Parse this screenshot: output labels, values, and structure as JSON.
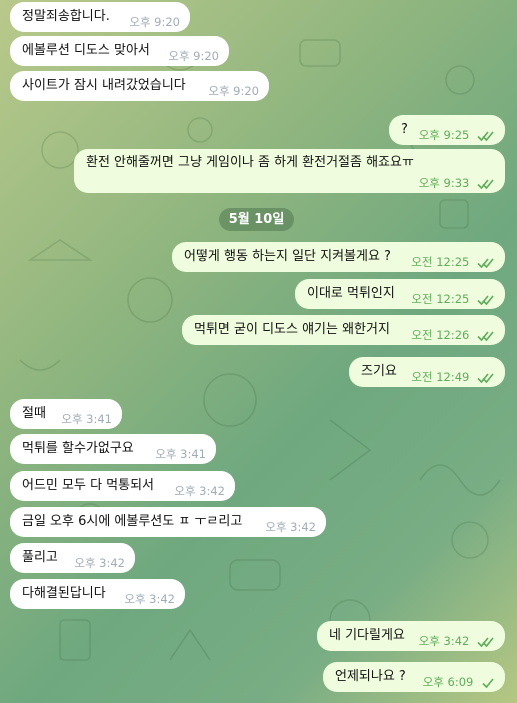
{
  "date_separator": "5월 10일",
  "colors": {
    "incoming_bubble": "#ffffff",
    "outgoing_bubble": "#effdde",
    "outgoing_meta": "#5fad5a",
    "incoming_meta": "#a0acb6"
  },
  "messages": [
    {
      "side": "in",
      "text": "정말죄송합니다.",
      "time": "오후 9:20"
    },
    {
      "side": "in",
      "text": "에볼루션 디도스 맞아서",
      "time": "오후 9:20"
    },
    {
      "side": "in",
      "text": "사이트가 잠시 내려갔었습니다",
      "time": "오후 9:20"
    },
    {
      "side": "out",
      "text": "?",
      "time": "오후 9:25",
      "status": "read"
    },
    {
      "side": "out",
      "text": "환전 안해줄꺼면 그냥 게임이나 좀 하게 환전거절좀 해죠요ㅠ",
      "time": "오후 9:33",
      "status": "read"
    },
    {
      "side": "out",
      "text": "어떻게 행동 하는지 일단 지켜볼게요 ?",
      "time": "오전 12:25",
      "status": "read"
    },
    {
      "side": "out",
      "text": "이대로 먹튀인지",
      "time": "오전 12:25",
      "status": "read"
    },
    {
      "side": "out",
      "text": "먹튀면 굳이 디도스 얘기는 왜한거지",
      "time": "오전 12:26",
      "status": "read"
    },
    {
      "side": "out",
      "text": "즈기요",
      "time": "오전 12:49",
      "status": "read"
    },
    {
      "side": "in",
      "text": "절때",
      "time": "오후 3:41"
    },
    {
      "side": "in",
      "text": "먹튀를 할수가없구요",
      "time": "오후 3:41"
    },
    {
      "side": "in",
      "text": "어드민 모두 다 먹통되서",
      "time": "오후 3:42"
    },
    {
      "side": "in",
      "text": "금일 오후 6시에 에볼루션도 ㅍ ㅜㄹ리고",
      "time": "오후 3:42"
    },
    {
      "side": "in",
      "text": "풀리고",
      "time": "오후 3:42"
    },
    {
      "side": "in",
      "text": "다해결된답니다",
      "time": "오후 3:42"
    },
    {
      "side": "out",
      "text": "네 기다릴게요",
      "time": "오후 3:42",
      "status": "read"
    },
    {
      "side": "out",
      "text": "언제되나요 ?",
      "time": "오후 6:09",
      "status": "sent"
    }
  ]
}
